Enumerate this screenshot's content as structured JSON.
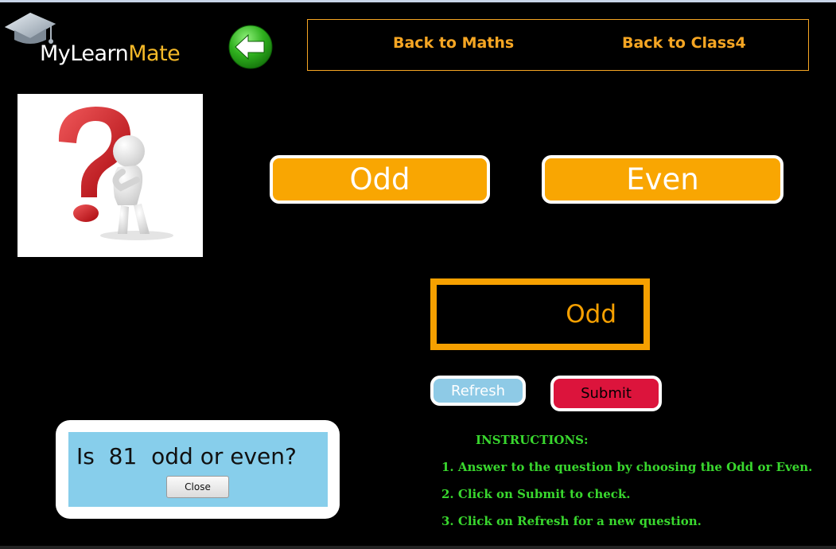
{
  "header": {
    "logo": {
      "part_my": "My",
      "part_learn": "Learn",
      "part_mate": "Mate",
      "icon": "graduation-cap-icon"
    },
    "back_icon": "left-arrow-circle-icon",
    "nav": {
      "maths_label": "Back to Maths",
      "class_label": "Back to Class4"
    }
  },
  "main": {
    "image_icon": "question-mark-figure-image",
    "options": {
      "odd_label": "Odd",
      "even_label": "Even"
    },
    "answer_value": "Odd",
    "refresh_label": "Refresh",
    "submit_label": "Submit"
  },
  "question_dialog": {
    "prefix": "Is",
    "number": "81",
    "suffix": "odd or even?",
    "close_label": "Close"
  },
  "instructions": {
    "title": "INSTRUCTIONS:",
    "steps": [
      "1. Answer to the question by choosing the Odd or Even.",
      "2. Click on Submit to check.",
      "3. Click on Refresh for a new question."
    ]
  },
  "colors": {
    "accent": "#f6a623",
    "option_bg": "#f9a602",
    "refresh_bg": "#8ecae6",
    "submit_bg": "#dc143c",
    "instructions_text": "#39d72e",
    "dialog_bg": "#87ceeb"
  }
}
